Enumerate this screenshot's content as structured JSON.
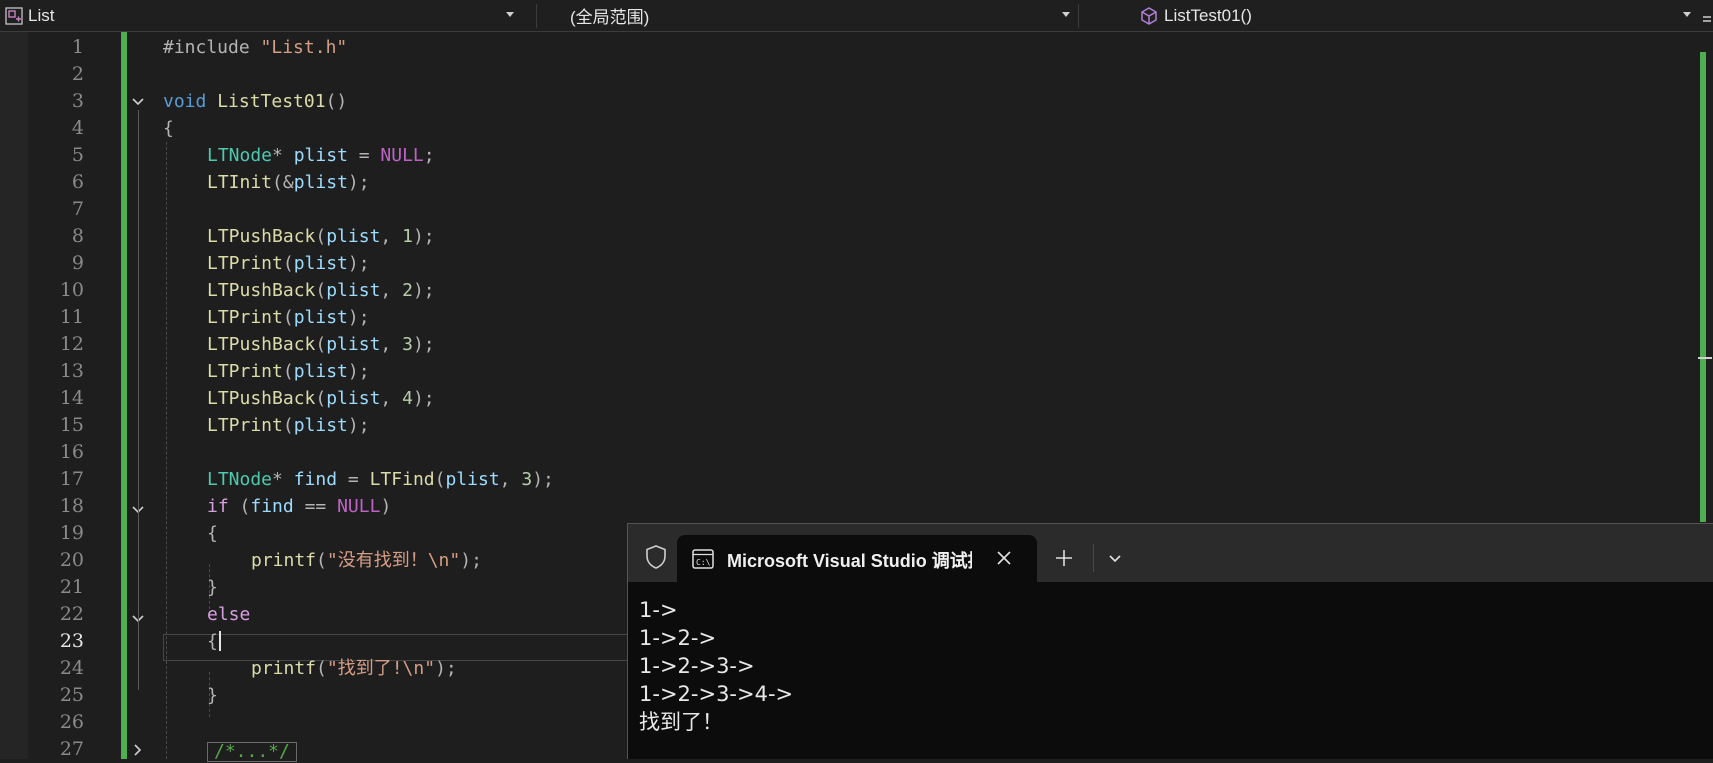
{
  "nav": {
    "project": "List",
    "scope": "(全局范围)",
    "function": "ListTest01()"
  },
  "line_numbers": [
    "1",
    "2",
    "3",
    "4",
    "5",
    "6",
    "7",
    "8",
    "9",
    "10",
    "11",
    "12",
    "13",
    "14",
    "15",
    "16",
    "17",
    "18",
    "19",
    "20",
    "21",
    "22",
    "23",
    "24",
    "25",
    "26",
    "27"
  ],
  "active_line": "23",
  "code": {
    "l1_pre": "#include ",
    "l1_str": "\"List.h\"",
    "l3_kw": "void",
    "l3_fn": "ListTest01",
    "l3_punc": "()",
    "brace_open": "{",
    "brace_close": "}",
    "ltnode": "LTNode",
    "star": "*",
    "plist": "plist",
    "eq": " = ",
    "null": "NULL",
    "semi": ";",
    "ltinit": "LTInit",
    "amp_open": "(&",
    "close_semi": ");",
    "open": "(",
    "comma": ", ",
    "ltpushback": "LTPushBack",
    "ltprint": "LTPrint",
    "n1": "1",
    "n2": "2",
    "n3": "3",
    "n4": "4",
    "find": "find",
    "ltfind": "LTFind",
    "if_kw": "if",
    "if_open": " (",
    "eqeq": " == ",
    "close": ")",
    "printf": "printf",
    "str_notfound": "\"没有找到！\\n\"",
    "else_kw": "else",
    "str_found": "\"找到了!\\n\"",
    "l27_comment": "/*...*/"
  },
  "terminal": {
    "tab_title": "Microsoft Visual Studio 调试控制台",
    "lines": [
      "1->",
      "1->2->",
      "1->2->3->",
      "1->2->3->4->",
      "找到了！"
    ]
  },
  "colors": {
    "change_bar": "#4fae4f",
    "keyword": "#569cd6",
    "type": "#4ec9b0",
    "function": "#dcdcaa",
    "variable": "#9cdcfe",
    "number": "#b5cea8",
    "string": "#d69d85",
    "macro": "#bd63c5",
    "control": "#d8a0df"
  },
  "icons": [
    "class-icon",
    "cube-icon",
    "chevron-down-icon",
    "shield-icon",
    "cmd-icon",
    "close-icon",
    "plus-icon"
  ]
}
